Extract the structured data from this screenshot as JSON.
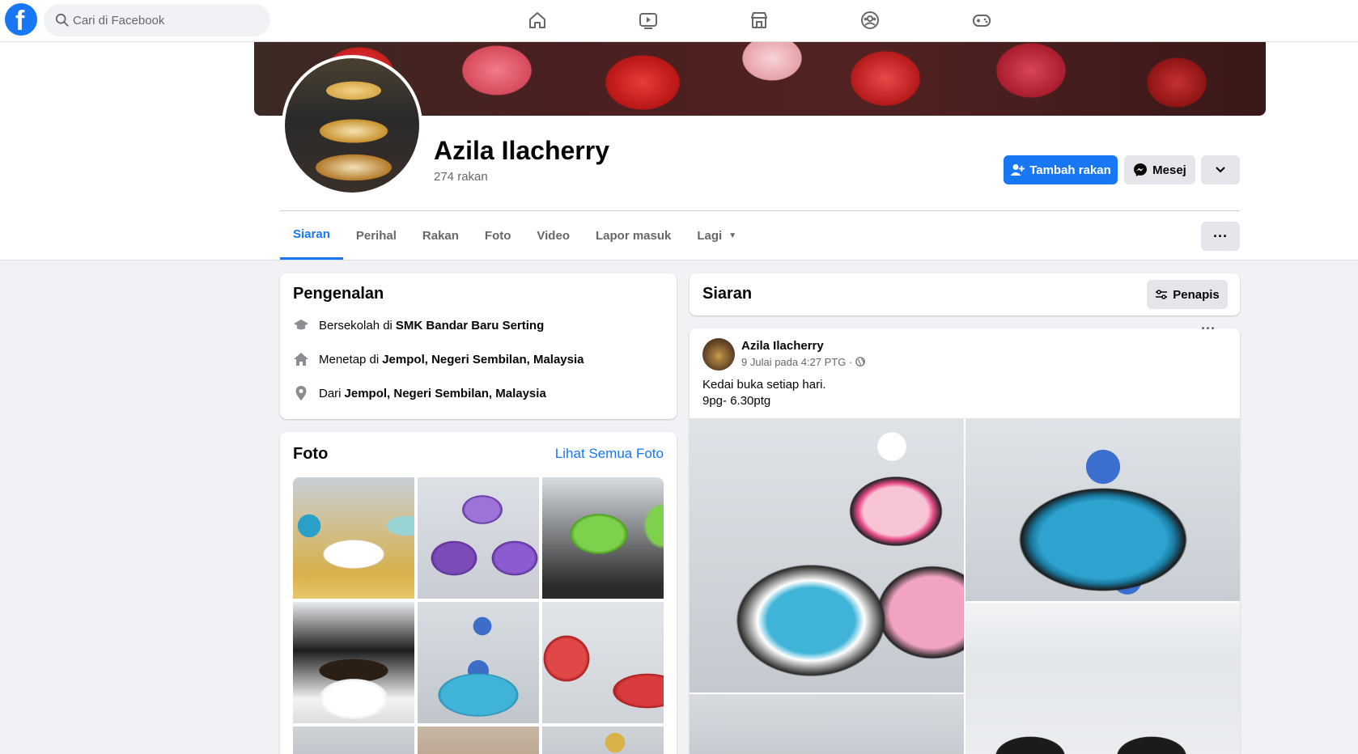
{
  "search": {
    "placeholder": "Cari di Facebook"
  },
  "profile": {
    "name": "Azila Ilacherry",
    "friends": "274 rakan"
  },
  "actions": {
    "add_friend": "Tambah rakan",
    "message": "Mesej",
    "more_icon": "⌄"
  },
  "tabs": [
    {
      "label": "Siaran"
    },
    {
      "label": "Perihal"
    },
    {
      "label": "Rakan"
    },
    {
      "label": "Foto"
    },
    {
      "label": "Video"
    },
    {
      "label": "Lapor masuk"
    },
    {
      "label": "Lagi"
    }
  ],
  "tab_menu": "···",
  "intro": {
    "title": "Pengenalan",
    "rows": [
      {
        "prefix": "Bersekolah di",
        "value": "SMK Bandar Baru Serting",
        "icon": "graduation-cap-icon"
      },
      {
        "prefix": "Menetap di",
        "value": "Jempol, Negeri Sembilan, Malaysia",
        "icon": "home-icon"
      },
      {
        "prefix": "Dari",
        "value": "Jempol, Negeri Sembilan, Malaysia",
        "icon": "location-pin-icon"
      }
    ]
  },
  "photos": {
    "title": "Foto",
    "see_all": "Lihat Semua Foto"
  },
  "posts_header": {
    "title": "Siaran",
    "filter": "Penapis"
  },
  "post": {
    "author": "Azila Ilacherry",
    "meta": "9 Julai pada 4:27 PTG · ",
    "line1": "Kedai buka setiap hari.",
    "line2": "9pg- 6.30ptg",
    "menu": "···"
  },
  "colors": {
    "accent": "#1877f2",
    "secondary_text": "#65676b"
  }
}
